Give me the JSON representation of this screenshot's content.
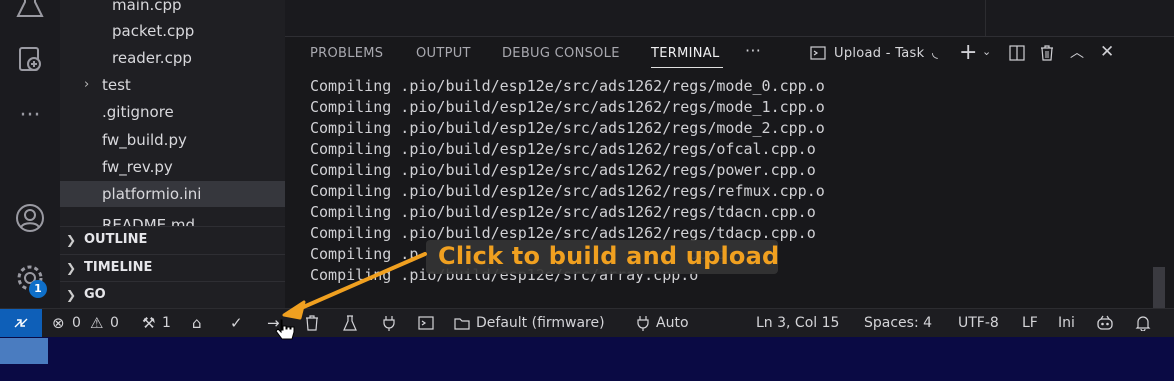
{
  "explorer": {
    "files": [
      "main.cpp",
      "packet.cpp",
      "reader.cpp"
    ],
    "folder_test": "test",
    "root_files": [
      ".gitignore",
      "fw_build.py",
      "fw_rev.py",
      "platformio.ini",
      "README.md"
    ],
    "sections": [
      "OUTLINE",
      "TIMELINE",
      "GO"
    ]
  },
  "activity": {
    "badge_count": "1"
  },
  "panel": {
    "tabs": [
      "PROBLEMS",
      "OUTPUT",
      "DEBUG CONSOLE",
      "TERMINAL"
    ],
    "more": "···",
    "task_label": "Upload - Task",
    "terminal_lines": [
      "Compiling .pio/build/esp12e/src/ads1262/regs/mode_0.cpp.o",
      "Compiling .pio/build/esp12e/src/ads1262/regs/mode_1.cpp.o",
      "Compiling .pio/build/esp12e/src/ads1262/regs/mode_2.cpp.o",
      "Compiling .pio/build/esp12e/src/ads1262/regs/ofcal.cpp.o",
      "Compiling .pio/build/esp12e/src/ads1262/regs/power.cpp.o",
      "Compiling .pio/build/esp12e/src/ads1262/regs/refmux.cpp.o",
      "Compiling .pio/build/esp12e/src/ads1262/regs/tdacn.cpp.o",
      "Compiling .pio/build/esp12e/src/ads1262/regs/tdacp.cpp.o",
      "Compiling .p                              op.o",
      "Compiling .pio/build/esp12e/src/array.cpp.o"
    ]
  },
  "statusbar": {
    "errors": "0",
    "warnings": "0",
    "ports": "1",
    "env": "Default (firmware)",
    "port_mode": "Auto",
    "position": "Ln 3, Col 15",
    "spaces": "Spaces: 4",
    "encoding": "UTF-8",
    "eol": "LF",
    "language": "Ini"
  },
  "callout": {
    "text": "Click to build and upload"
  },
  "colors": {
    "accent": "#0e5fb8",
    "callout": "#f0a020",
    "background": "#0a0a44"
  }
}
